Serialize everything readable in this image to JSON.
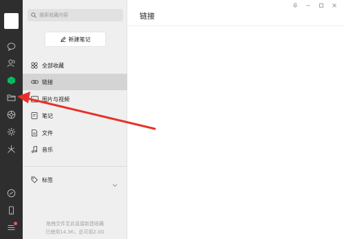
{
  "sidebar": {
    "icons": [
      "chat-icon",
      "contacts-icon",
      "favorites-icon",
      "folder-icon",
      "moments-icon",
      "mini-program-icon",
      "channels-icon",
      "miniprogram-panel-icon",
      "phone-icon",
      "menu-icon"
    ]
  },
  "panel": {
    "search_placeholder": "搜索收藏内容",
    "new_note_label": "新建笔记",
    "items": [
      {
        "label": "全部收藏",
        "icon": "grid-icon"
      },
      {
        "label": "链接",
        "icon": "link-icon"
      },
      {
        "label": "图片与视频",
        "icon": "image-icon"
      },
      {
        "label": "笔记",
        "icon": "note-icon"
      },
      {
        "label": "文件",
        "icon": "file-icon"
      },
      {
        "label": "音乐",
        "icon": "music-icon"
      }
    ],
    "tags_label": "标签",
    "footer_hint": "拖拽文件至此直接新建收藏",
    "footer_usage": "已使用14.3K，总可用2.0G"
  },
  "main": {
    "title": "链接"
  },
  "colors": {
    "rail_bg": "#2e2e2e",
    "panel_bg": "#efefef",
    "active_item_bg": "#d4d4d4",
    "accent_green": "#07c160",
    "annotation_red": "#e8302a"
  }
}
